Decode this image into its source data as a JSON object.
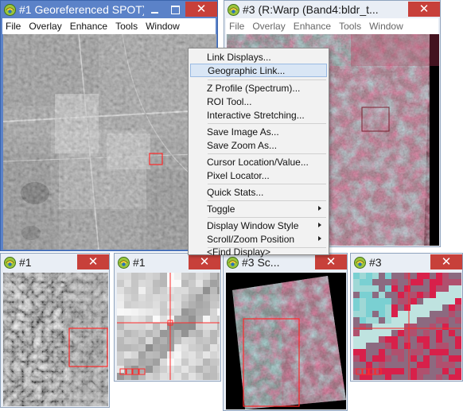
{
  "win1": {
    "title": "#1 Georeferenced SPOT):...",
    "menus": [
      "File",
      "Overlay",
      "Enhance",
      "Tools",
      "Window"
    ]
  },
  "win3": {
    "title": "#3 (R:Warp (Band4:bldr_t...",
    "menus": [
      "File",
      "Overlay",
      "Enhance",
      "Tools",
      "Window"
    ]
  },
  "scroll1": {
    "title": "#1"
  },
  "zoom1": {
    "title": "#1"
  },
  "scroll3": {
    "title": "#3 Sc..."
  },
  "zoom3": {
    "title": "#3"
  },
  "close_glyph": "✕",
  "context_menu": {
    "items": [
      "Link Displays...",
      "Geographic Link...",
      "Z Profile (Spectrum)...",
      "ROI Tool...",
      "Interactive Stretching...",
      "Save Image As...",
      "Save Zoom As...",
      "Cursor Location/Value...",
      "Pixel Locator...",
      "Quick Stats...",
      "Toggle",
      "Display Window Style",
      "Scroll/Zoom Position",
      "<Find Display>"
    ],
    "highlighted": "Geographic Link...",
    "submenu_items": [
      "Toggle",
      "Display Window Style",
      "Scroll/Zoom Position"
    ]
  },
  "colors": {
    "active_title_bar": "#5b82c8",
    "inactive_title_bar": "#e9eef5",
    "close_button": "#c7403a",
    "menu_highlight": "#d9e6f5",
    "overlay_box": "#ff2a2a",
    "false_color_red": "#d8204a",
    "false_color_cyan": "#5fd0d0"
  }
}
